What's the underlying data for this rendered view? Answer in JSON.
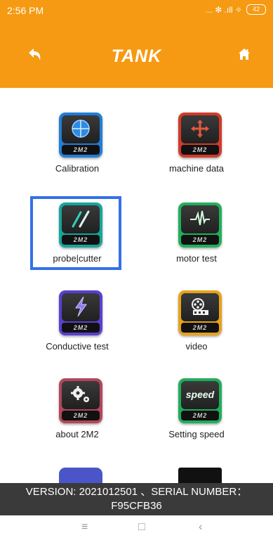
{
  "status_bar": {
    "time": "2:56 PM",
    "icons": "... ✻ .ıll ✧",
    "battery": "42"
  },
  "header": {
    "title": "TANK",
    "back_icon": "back-arrow-icon",
    "home_icon": "home-icon",
    "background": "#f59a12"
  },
  "menu": {
    "items": [
      {
        "label": "Calibration",
        "color": "#1f7fd6",
        "icon": "crosshair-icon"
      },
      {
        "label": "machine data",
        "color": "#d23a2a",
        "icon": "move-arrows-icon"
      },
      {
        "label": "probe|cutter",
        "color": "#16a59a",
        "icon": "probe-cutter-icon",
        "selected": true
      },
      {
        "label": "motor test",
        "color": "#1fb05a",
        "icon": "waveform-icon"
      },
      {
        "label": "Conductive test",
        "color": "#5a3fd0",
        "icon": "lightning-icon"
      },
      {
        "label": "video",
        "color": "#e8a21a",
        "icon": "film-reel-icon"
      },
      {
        "label": "about 2M2",
        "color": "#b2465c",
        "icon": "gears-icon"
      },
      {
        "label": "Setting speed",
        "color": "#1fae5c",
        "icon": "speed-icon"
      }
    ],
    "tile_brand": "2M2",
    "speed_text": "speed"
  },
  "version_bar": {
    "line1": "VERSION: 2021012501 、SERIAL NUMBER：",
    "line2": "F95CFB36"
  },
  "nav_bar": {
    "menu": "≡",
    "home": "□",
    "back": "‹"
  }
}
